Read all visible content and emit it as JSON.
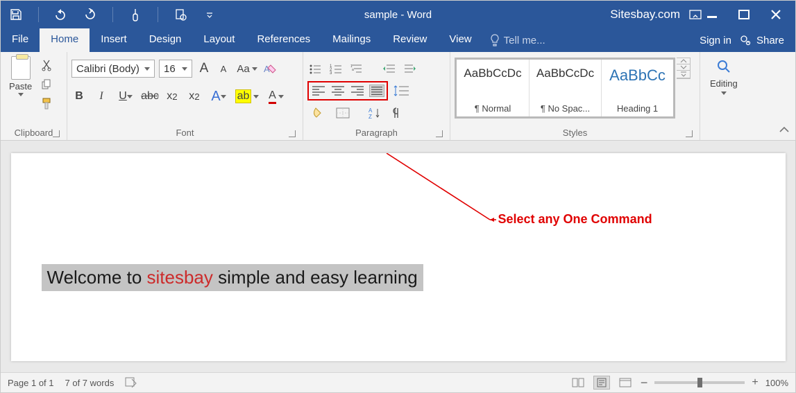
{
  "title_bar": {
    "doc_title": "sample - Word",
    "site": "Sitesbay.com"
  },
  "tabs": {
    "file": "File",
    "home": "Home",
    "insert": "Insert",
    "design": "Design",
    "layout": "Layout",
    "references": "References",
    "mailings": "Mailings",
    "review": "Review",
    "view": "View",
    "tell_me": "Tell me...",
    "sign_in": "Sign in",
    "share": "Share"
  },
  "ribbon": {
    "clipboard": {
      "label": "Clipboard",
      "paste": "Paste"
    },
    "font": {
      "label": "Font",
      "font_name": "Calibri (Body)",
      "font_size": "16",
      "grow": "A",
      "shrink": "A",
      "case": "Aa",
      "b": "B",
      "i": "I",
      "u": "U",
      "strike": "abc",
      "x2_sub": "x",
      "x2_sub_s": "2",
      "x2_sup": "x",
      "x2_sup_s": "2",
      "effect": "A",
      "hl": "ab",
      "color": "A"
    },
    "paragraph": {
      "label": "Paragraph",
      "sort": "A",
      "sort2": "Z"
    },
    "styles": {
      "label": "Styles",
      "preview": "AaBbCcDc",
      "head_preview": "AaBbCc",
      "normal": "¶ Normal",
      "nospacing": "¶ No Spac...",
      "heading1": "Heading 1"
    },
    "editing": {
      "label": "Editing"
    }
  },
  "callout": "Select any One Command",
  "document": {
    "pre": "Welcome to ",
    "mid": "sitesbay",
    "post": " simple and easy learning"
  },
  "status": {
    "page": "Page 1 of 1",
    "words": "7 of 7 words",
    "zoom": "100%",
    "minus": "−",
    "plus": "+"
  }
}
